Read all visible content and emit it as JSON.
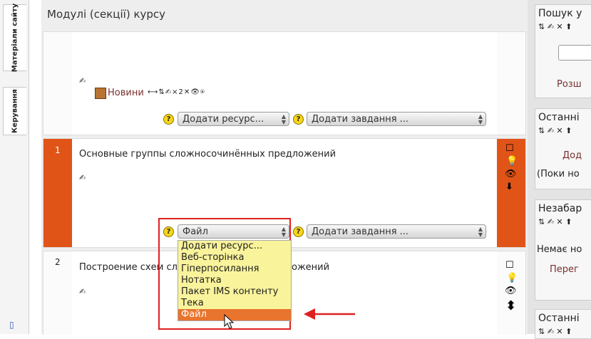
{
  "left_tabs": {
    "site_materials": "Матеріали сайту",
    "manage": "Керування"
  },
  "main": {
    "title": "Модулі (секції) курсу",
    "section0": {
      "news_link": "Новини",
      "news_tools": "⟷⇅✍×2✕👁⍟",
      "add_resource": "Додати ресурс...",
      "add_activity": "Додати завдання ..."
    },
    "section1": {
      "number": "1",
      "title": "Основные группы сложносочинённых предложений",
      "resource_value": "Файл",
      "add_activity": "Додати завдання ..."
    },
    "section2": {
      "number": "2",
      "title_left": "Построение схем сло",
      "title_right": "ожений"
    },
    "dropdown": {
      "options": [
        "Додати ресурс...",
        "Веб-сторінка",
        "Гіперпосилання",
        "Нотатка",
        "Пакет IMS контенту",
        "Тека",
        "Файл"
      ],
      "selected": "Файл"
    }
  },
  "right": {
    "block1": {
      "title": "Пошук у",
      "link": "Розш"
    },
    "block2": {
      "title": "Останні",
      "link": "Дод",
      "text": "(Поки но"
    },
    "block3": {
      "title": "Незабар",
      "text": "Немає но",
      "link": "Перег"
    },
    "block4": {
      "title": "Останні"
    }
  },
  "colors": {
    "current_section": "#e15418",
    "dropdown_bg": "#f9f39b",
    "selected_option": "#e8742e",
    "highlight_border": "#e02020",
    "arrow": "#e02020"
  }
}
